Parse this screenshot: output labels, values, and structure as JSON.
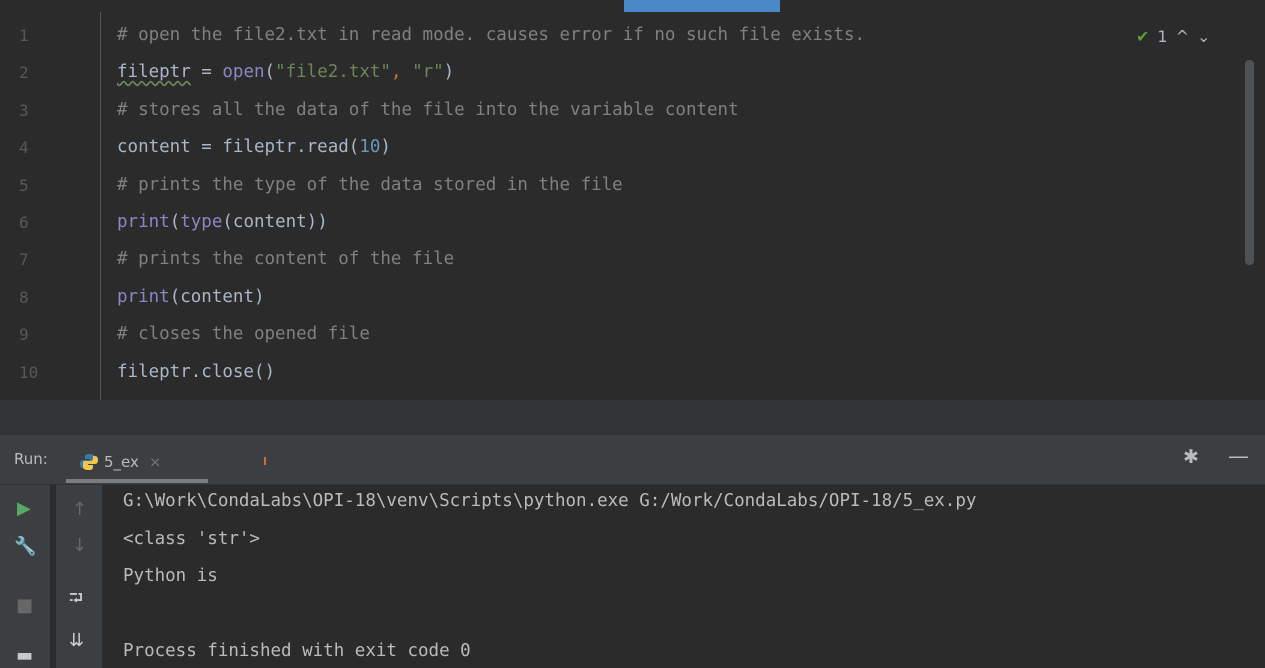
{
  "editor": {
    "lines": [
      {
        "num": "1",
        "parts": [
          {
            "t": "# open the file2.txt in read mode. causes error if no such file exists.",
            "c": "cmt"
          }
        ]
      },
      {
        "num": "2",
        "parts": [
          {
            "t": "fileptr",
            "c": "squig"
          },
          {
            "t": " = ",
            "c": ""
          },
          {
            "t": "open",
            "c": "fn"
          },
          {
            "t": "(",
            "c": ""
          },
          {
            "t": "\"file2.txt\"",
            "c": "str"
          },
          {
            "t": ", ",
            "c": "op"
          },
          {
            "t": "\"r\"",
            "c": "str"
          },
          {
            "t": ")",
            "c": ""
          }
        ]
      },
      {
        "num": "3",
        "parts": [
          {
            "t": "# stores all the data of the file into the variable content",
            "c": "cmt"
          }
        ]
      },
      {
        "num": "4",
        "parts": [
          {
            "t": "content = fileptr.read(",
            "c": ""
          },
          {
            "t": "10",
            "c": "num"
          },
          {
            "t": ")",
            "c": ""
          }
        ]
      },
      {
        "num": "5",
        "parts": [
          {
            "t": "# prints the type of the data stored in the file",
            "c": "cmt"
          }
        ]
      },
      {
        "num": "6",
        "parts": [
          {
            "t": "print",
            "c": "fn"
          },
          {
            "t": "(",
            "c": ""
          },
          {
            "t": "type",
            "c": "fn"
          },
          {
            "t": "(content))",
            "c": ""
          }
        ]
      },
      {
        "num": "7",
        "parts": [
          {
            "t": "# prints the content of the file",
            "c": "cmt"
          }
        ]
      },
      {
        "num": "8",
        "parts": [
          {
            "t": "print",
            "c": "fn"
          },
          {
            "t": "(content)",
            "c": ""
          }
        ]
      },
      {
        "num": "9",
        "parts": [
          {
            "t": "# closes the opened file",
            "c": "cmt"
          }
        ]
      },
      {
        "num": "10",
        "parts": [
          {
            "t": "fileptr.close()",
            "c": ""
          }
        ]
      }
    ],
    "inspection": {
      "check": "✔",
      "count": "1",
      "up": "^",
      "down": "⌄"
    }
  },
  "run_panel": {
    "label": "Run:",
    "tab_icon": "python-icon",
    "tab_name": "5_ex",
    "tab_close": "×",
    "settings_icon": "gear-icon",
    "minimize_icon": "minimize-icon",
    "tools": {
      "rerun": "▶",
      "wrench": "🔧",
      "stop": "■",
      "layout": "▬",
      "up": "↑",
      "down": "↓",
      "wrap": "⮒",
      "scroll_end": "⇊"
    },
    "output": [
      "G:\\Work\\CondaLabs\\OPI-18\\venv\\Scripts\\python.exe G:/Work/CondaLabs/OPI-18/5_ex.py",
      "<class 'str'>",
      "Python is",
      "",
      "Process finished with exit code 0"
    ]
  }
}
